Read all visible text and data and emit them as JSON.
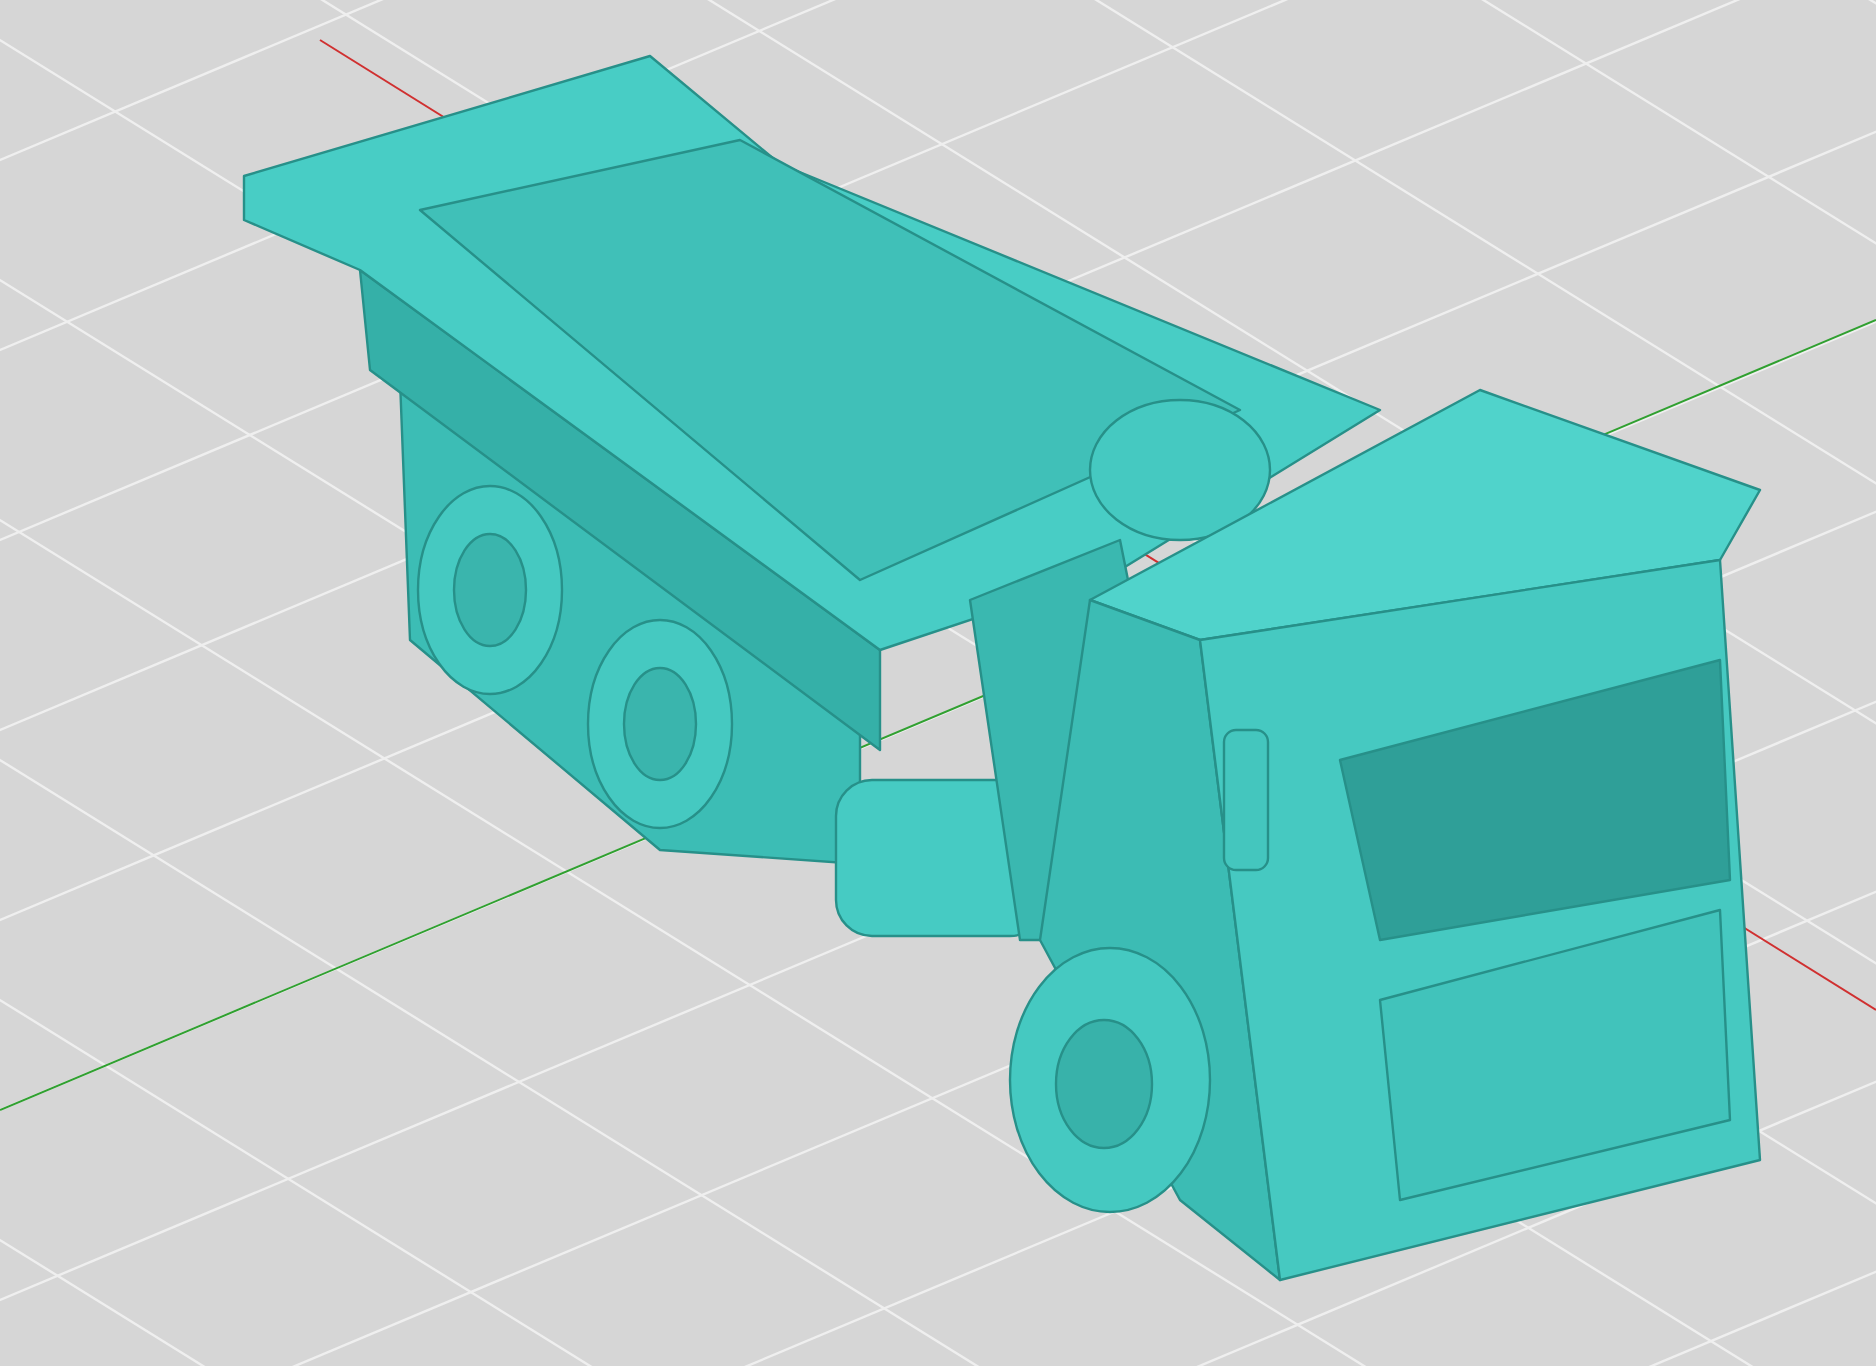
{
  "viewport": {
    "axes": [
      {
        "color": "#d03030"
      },
      {
        "color": "#30a030"
      }
    ]
  }
}
